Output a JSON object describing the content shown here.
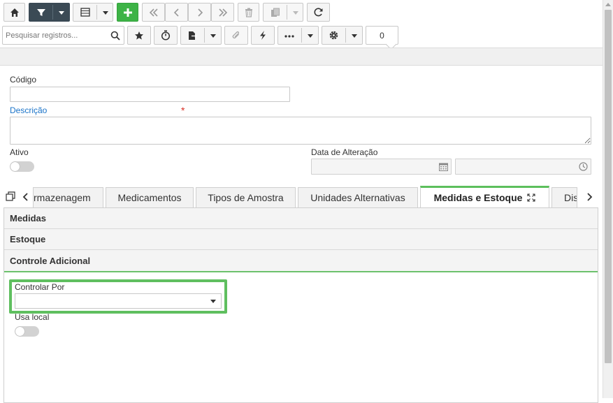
{
  "toolbar": {
    "search_placeholder": "Pesquisar registros...",
    "record_count": "0",
    "accent_color": "#3db346",
    "icons": [
      "home-icon",
      "filter-icon",
      "grid-view-icon",
      "add-icon",
      "first-icon",
      "previous-icon",
      "next-icon",
      "last-icon",
      "delete-icon",
      "copy-icon",
      "refresh-icon",
      "search-icon",
      "star-icon",
      "stopwatch-icon",
      "export-icon",
      "attach-icon",
      "lightning-icon",
      "more-icon",
      "gear-icon"
    ]
  },
  "form": {
    "codigo_label": "Código",
    "codigo_value": "",
    "descricao_label": "Descrição",
    "required_mark": "*",
    "descricao_value": "",
    "ativo_label": "Ativo",
    "data_alteracao_label": "Data de Alteração",
    "data_value": "",
    "hora_value": ""
  },
  "tabs": [
    {
      "label": "rmazenagem"
    },
    {
      "label": "Medicamentos"
    },
    {
      "label": "Tipos de Amostra"
    },
    {
      "label": "Unidades Alternativas"
    },
    {
      "label": "Medidas e Estoque",
      "active": true
    },
    {
      "label": "Dis"
    }
  ],
  "sections": {
    "medidas": "Medidas",
    "estoque": "Estoque",
    "controle": "Controle Adicional"
  },
  "controle": {
    "controlar_por_label": "Controlar Por",
    "controlar_por_value": "",
    "usa_local_label": "Usa local"
  }
}
